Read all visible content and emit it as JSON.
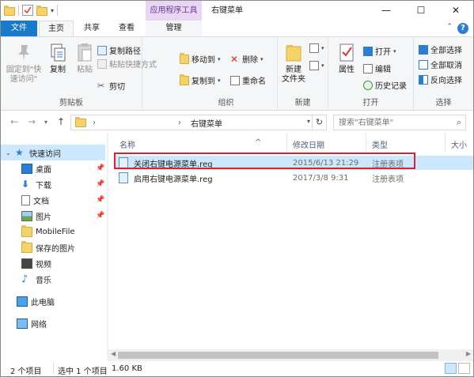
{
  "window": {
    "title": "右键菜单",
    "contextual_tab": "应用程序工具",
    "controls": {
      "minimize": "—",
      "maximize": "☐",
      "close": "✕"
    }
  },
  "tabs": {
    "file": "文件",
    "home": "主页",
    "share": "共享",
    "view": "查看",
    "manage": "管理"
  },
  "ribbon": {
    "clipboard": {
      "label": "剪贴板",
      "pin": "固定到\"快\n速访问\"",
      "copy": "复制",
      "paste": "粘贴",
      "copy_path": "复制路径",
      "paste_shortcut": "粘贴快捷方式",
      "cut": "剪切"
    },
    "organize": {
      "label": "组织",
      "move_to": "移动到",
      "copy_to": "复制到",
      "delete": "删除",
      "rename": "重命名"
    },
    "new": {
      "label": "新建",
      "new_folder": "新建\n文件夹"
    },
    "open": {
      "label": "打开",
      "properties": "属性",
      "open": "打开",
      "edit": "编辑",
      "history": "历史记录"
    },
    "select": {
      "label": "选择",
      "select_all": "全部选择",
      "select_none": "全部取消",
      "invert": "反向选择"
    }
  },
  "address": {
    "path": "右键菜单",
    "search_placeholder": "搜索\"右键菜单\""
  },
  "nav": {
    "quick_access": "快速访问",
    "items": [
      {
        "label": "桌面",
        "pinned": true
      },
      {
        "label": "下载",
        "pinned": true
      },
      {
        "label": "文档",
        "pinned": true
      },
      {
        "label": "图片",
        "pinned": true
      },
      {
        "label": "MobileFile",
        "pinned": false
      },
      {
        "label": "保存的图片",
        "pinned": false
      },
      {
        "label": "视频",
        "pinned": false
      },
      {
        "label": "音乐",
        "pinned": false
      }
    ],
    "this_pc": "此电脑",
    "network": "网络"
  },
  "columns": {
    "name": "名称",
    "modified": "修改日期",
    "type": "类型",
    "size": "大小"
  },
  "files": [
    {
      "name": "关闭右键电源菜单.reg",
      "modified": "2015/6/13 21:29",
      "type": "注册表项",
      "selected": true
    },
    {
      "name": "启用右键电源菜单.reg",
      "modified": "2017/3/8 9:31",
      "type": "注册表项",
      "selected": false
    }
  ],
  "status": {
    "count": "2 个项目",
    "selection": "选中 1 个项目",
    "size": "1.60 KB"
  },
  "colors": {
    "accent": "#1979ca",
    "selection": "#cce8ff",
    "highlight_border": "#e0202a",
    "contextual": "#e8d6f3"
  }
}
